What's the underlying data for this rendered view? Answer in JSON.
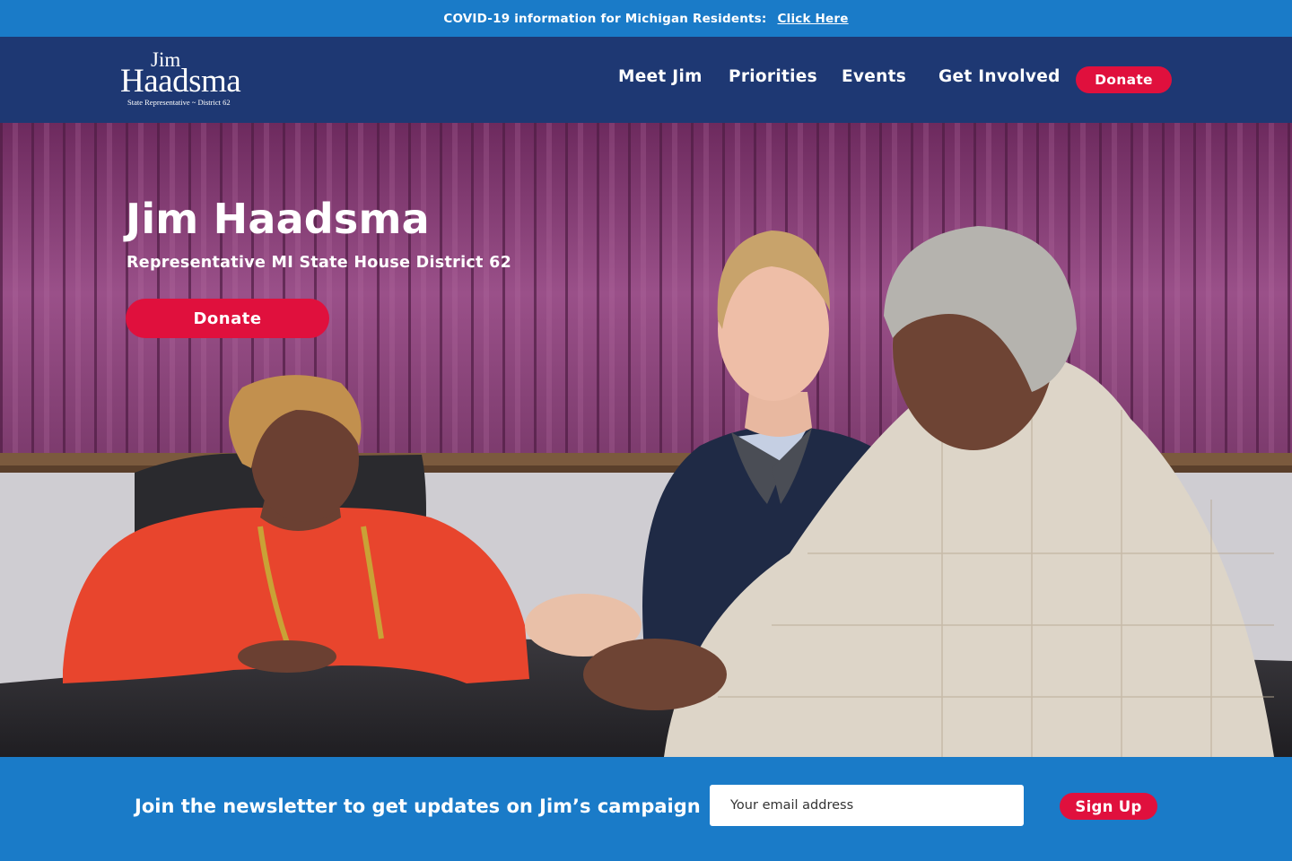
{
  "alert": {
    "text": "COVID-19 information for Michigan Residents:",
    "link_label": "Click Here"
  },
  "logo": {
    "first": "Jim",
    "last": "Haadsma",
    "subtitle": "State Representative ~ District 62"
  },
  "nav": {
    "items": [
      {
        "label": "Meet Jim"
      },
      {
        "label": "Priorities"
      },
      {
        "label": "Events"
      },
      {
        "label": "Get Involved"
      }
    ],
    "donate_label": "Donate"
  },
  "hero": {
    "title": "Jim Haadsma",
    "subtitle": "Representative MI State House District 62",
    "donate_label": "Donate"
  },
  "newsletter": {
    "text": "Join the newsletter to get updates on Jim’s campaign",
    "email_placeholder": "Your email address",
    "signup_label": "Sign Up"
  },
  "colors": {
    "alert_bg": "#1a7bc8",
    "header_bg": "#1e3873",
    "accent_red": "#e0103d",
    "newsletter_bg": "#1a7bc8"
  }
}
